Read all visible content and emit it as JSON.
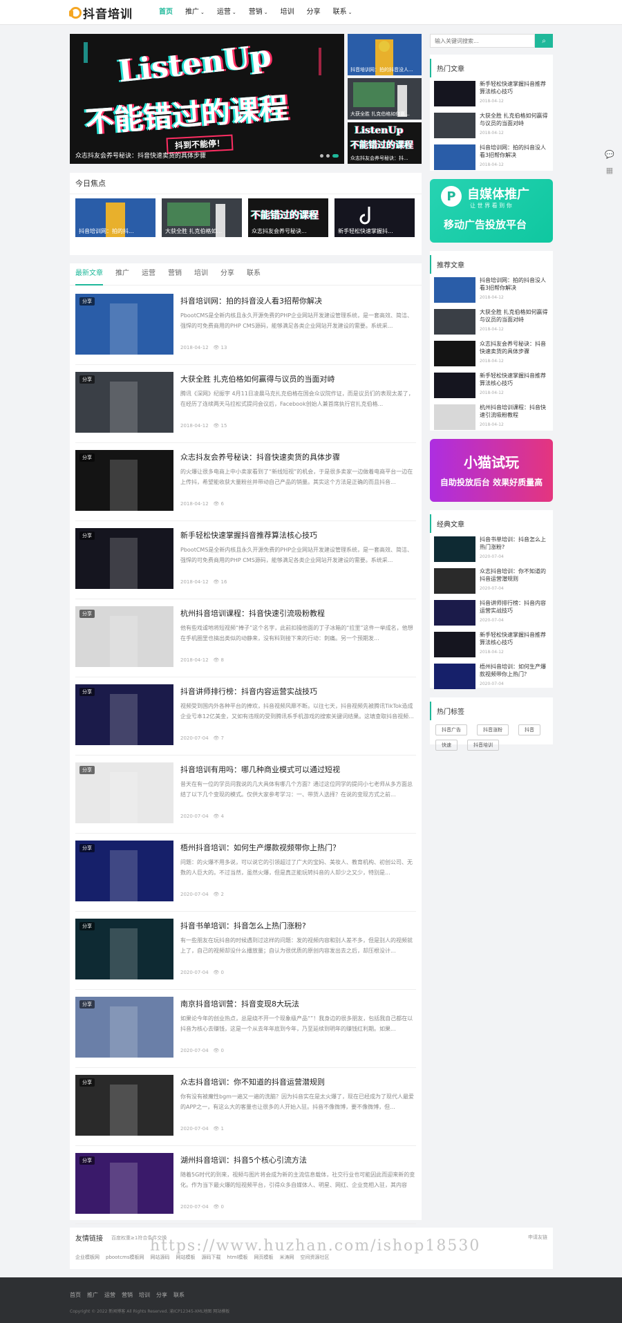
{
  "header": {
    "logo_text": "抖音培训",
    "nav": [
      {
        "label": "首页",
        "caret": false,
        "active": true
      },
      {
        "label": "推广",
        "caret": true,
        "active": false
      },
      {
        "label": "运营",
        "caret": true,
        "active": false
      },
      {
        "label": "营销",
        "caret": true,
        "active": false
      },
      {
        "label": "培训",
        "caret": false,
        "active": false
      },
      {
        "label": "分享",
        "caret": false,
        "active": false
      },
      {
        "label": "联系",
        "caret": true,
        "active": false
      }
    ]
  },
  "slider": {
    "main_title": "众志抖友会养号秘诀：抖音快速卖货的具体步骤",
    "image_text_1": "ListenUp",
    "image_text_2": "不能错过的课程",
    "image_text_3": "抖到不能停！",
    "side": [
      {
        "caption": "抖音培训网：拍的抖音没人..."
      },
      {
        "caption": "大获全胜 扎克伯格如何赢..."
      },
      {
        "caption": "众志抖友会养号秘诀：抖..."
      }
    ]
  },
  "focus": {
    "title": "今日焦点",
    "items": [
      {
        "caption": "抖音培训网：拍的抖..."
      },
      {
        "caption": "大获全胜 扎克伯格如..."
      },
      {
        "caption": "众志抖友会养号秘诀..."
      },
      {
        "caption": "新手轻松快速掌握抖..."
      }
    ]
  },
  "list": {
    "tabs": [
      "最新文章",
      "推广",
      "运营",
      "营销",
      "培训",
      "分享",
      "联系"
    ],
    "articles": [
      {
        "badge": "分享",
        "title": "抖音培训网：拍的抖音没人看3招帮你解决",
        "summary": "PbootCMS是全新内核且永久开源免费的PHP企业网站开发建设管理系统，是一套高效、简洁、强悍的可免费商用的PHP CMS源码，能够满足各类企业网站开发建设的需要。系统采...",
        "date": "2018-04-12",
        "views": "13"
      },
      {
        "badge": "分享",
        "title": "大获全胜 扎克伯格如何赢得与议员的当面对峙",
        "summary": "腾讯《深网》纪振宇 4月11日凌晨马克扎克伯格在国会众议院作证，而是议员们的表现太差了，在经历了连续两天马拉松式提问会议后，Facebook创始人兼首席执行官扎克伯格...",
        "date": "2018-04-12",
        "views": "15"
      },
      {
        "badge": "分享",
        "title": "众志抖友会养号秘诀：抖音快速卖货的具体步骤",
        "summary": "的火爆让很多电商上中小卖家看到了“新线短视”的机会，于是很多卖家一边做着电商平台一边在上传抖，希望能收获大量粉丝并带动自己产品的销量。其实这个方法是正确的而且抖音...",
        "date": "2018-04-12",
        "views": "6"
      },
      {
        "badge": "分享",
        "title": "新手轻松快速掌握抖音推荐算法核心技巧",
        "summary": "PbootCMS是全新内核且永久开源免费的PHP企业网站开发建设管理系统，是一套高效、简洁、强悍的可免费商用的PHP CMS源码，能够满足各类企业网站开发建设的需要。系统采...",
        "date": "2018-04-12",
        "views": "16"
      },
      {
        "badge": "分享",
        "title": "杭州抖音培训课程：抖音快速引流吸粉教程",
        "summary": "他有些戏谑地将短视频“捧子”这个名字，此前扣操他面的丁子冰箱的“拉里”这件一举成名，他想在手机圈里也搞出类似的动静来，没有料到接下来的行动：刺痛。另一个预期发...",
        "date": "2018-04-12",
        "views": "8"
      },
      {
        "badge": "分享",
        "title": "抖音讲师排行榜：抖音内容运营实战技巧",
        "summary": "视频受到国内外各种平台的捧欢，抖音视频风靡不断。以往七天，抖音视频先被腾讯TikTok造成企业亏本12亿美金，又如有违规的受到腾讯系手机游戏的搜索关键词结果。这填查取抖音视频...",
        "date": "2020-07-04",
        "views": "7"
      },
      {
        "badge": "分享",
        "title": "抖音培训有用吗：哪几种商业模式可以通过短视",
        "summary": "昔天在有一位的学员问我说的几大具体有哪几个方面？通过这位同学的提问小七老师从多方面总结了以下几个变现的模式。仅供大家参考学习：一、带货人选择？在说的变现方式之前...",
        "date": "2020-07-04",
        "views": "4"
      },
      {
        "badge": "分享",
        "title": "梧州抖音培训：如何生产爆款视频带你上热门？",
        "summary": "问题：的火爆不用多说，可以说它的引领超过了广大的宝妈、美妆人、教育机构、初创公司、无数的人巨大的。不过当然，虽然火爆，但是真正能玩转抖音的人却少之又少，特别是...",
        "date": "2020-07-04",
        "views": "2"
      },
      {
        "badge": "分享",
        "title": "抖音书单培训：抖音怎么上热门涨粉?",
        "summary": "有一些朋友在玩抖音的时候遇到过这样的问题：发的视频内容和别人差不多，但是别人的视频就上了，自己的视频却没什么播放量；自认为很优质的原创内容发出去之后，却压根没计...",
        "date": "2020-07-04",
        "views": "0"
      },
      {
        "badge": "分享",
        "title": "南京抖音培训营：抖音变现8大玩法",
        "summary": "如果论今年的创业热点，总是绕不开一个现象级产品“”！我身边的很多朋友，包括我自己都在以抖音为核心去赚钱，这是一个从去年年底到今年，乃至延续到明年的赚钱红利期。如果...",
        "date": "2020-07-04",
        "views": "0"
      },
      {
        "badge": "分享",
        "title": "众志抖音培训：你不知道的抖音运营潜规则",
        "summary": "你有没有被魔性bgm一遍又一遍的洗脑？因为抖音实在是太火爆了，现在已经成为了现代人最爱的APP之一，有这么大的客量也让很多的人开始入驻。抖音不像微博，要不像微博，但...",
        "date": "2020-07-04",
        "views": "1"
      },
      {
        "badge": "分享",
        "title": "湖州抖音培训：抖音5个核心引流方法",
        "summary": "随着5G时代的到来，视频与图片将会成为新的主流信息载体，社交行业也可能因此而迎来新的变化。作为当下最火爆的短视频平台，引得众多自媒体人、明星、网红、企业竞相入驻，其内容更...",
        "date": "2020-07-04",
        "views": "0"
      }
    ]
  },
  "sidebar": {
    "search_placeholder": "输入关键词搜索...",
    "hot": {
      "title": "热门文章",
      "items": [
        {
          "title": "新手轻松快速掌握抖音推荐算法核心技巧",
          "date": "2018-04-12"
        },
        {
          "title": "大获全胜 扎克伯格如何赢得与议员的当面对峙",
          "date": "2018-04-12"
        },
        {
          "title": "抖音培训网：拍的抖音没人看3招帮你解决",
          "date": "2018-04-12"
        }
      ]
    },
    "ad1": {
      "main": "自媒体推广",
      "sub": "让 世 界 看 到 你",
      "line": "移动广告投放平台"
    },
    "recommend": {
      "title": "推荐文章",
      "items": [
        {
          "title": "抖音培训网：拍的抖音没人看3招帮你解决",
          "date": "2018-04-12"
        },
        {
          "title": "大获全胜 扎克伯格如何赢得与议员的当面对峙",
          "date": "2018-04-12"
        },
        {
          "title": "众志抖友会养号秘诀：抖音快速卖货的具体步骤",
          "date": "2018-04-12"
        },
        {
          "title": "新手轻松快速掌握抖音推荐算法核心技巧",
          "date": "2018-04-12"
        },
        {
          "title": "杭州抖音培训课程：抖音快速引流吸粉教程",
          "date": "2018-04-12"
        }
      ]
    },
    "ad2": {
      "main": "小猫试玩",
      "line": "自助投放后台 效果好质量高"
    },
    "classic": {
      "title": "经典文章",
      "items": [
        {
          "title": "抖音书单培训：抖音怎么上热门涨粉?",
          "date": "2020-07-04"
        },
        {
          "title": "众志抖音培训：你不知道的抖音运营潜规则",
          "date": "2020-07-04"
        },
        {
          "title": "抖音讲师排行榜：抖音内容运营实战技巧",
          "date": "2020-07-04"
        },
        {
          "title": "新手轻松快速掌握抖音推荐算法核心技巧",
          "date": "2018-04-12"
        },
        {
          "title": "梧州抖音培训：如何生产爆款视频带你上热门？",
          "date": "2020-07-04"
        }
      ]
    },
    "tags": {
      "title": "热门标签",
      "items": [
        "抖音广告",
        "抖音涨粉",
        "抖音",
        "快速",
        "抖音培训"
      ]
    }
  },
  "friend": {
    "title": "友情链接",
    "sub": "百度权重≥1符合条件交换",
    "apply": "申请友链",
    "links": [
      "企业模板网",
      "pbootcms模板网",
      "网站源码",
      "网站模板",
      "源码下载",
      "html模板",
      "网页模板",
      "米涛网",
      "空间资源社区"
    ]
  },
  "footer": {
    "nav": [
      "首页",
      "推广",
      "运营",
      "营销",
      "培训",
      "分享",
      "联系"
    ],
    "copyright": "Copyright © 2022 新闻博客 All Rights Reserved. 渝ICP12345-XML地图 网站模板"
  },
  "watermark": "https://www.huzhan.com/ishop18530",
  "colors": {
    "accent": "#1fb89a",
    "footer": "#2e3033"
  }
}
